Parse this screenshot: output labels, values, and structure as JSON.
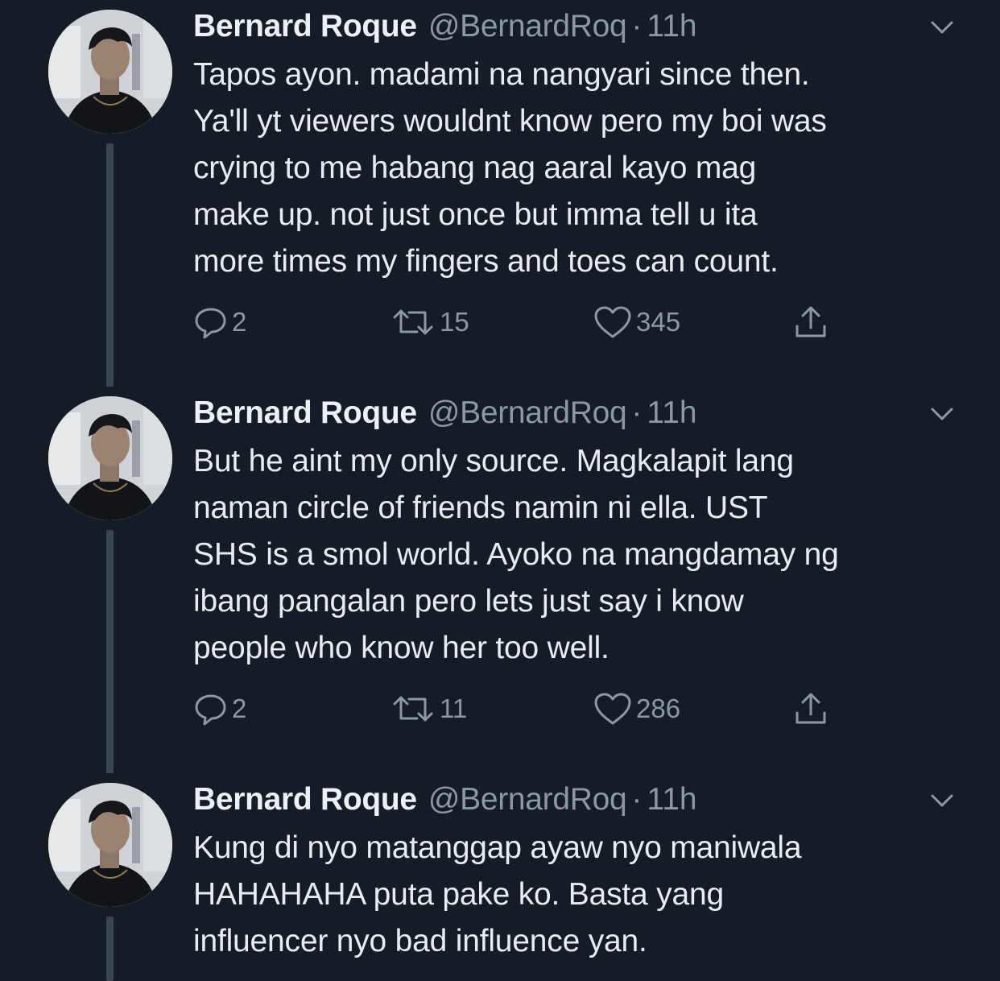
{
  "tweets": [
    {
      "author": {
        "name": "Bernard Roque",
        "handle": "@BernardRoq",
        "separator": "·",
        "time": "11h"
      },
      "lines": [
        "Tapos ayon. madami na nangyari since then.",
        "Ya'll yt viewers wouldnt know pero my boi was",
        "crying to me habang nag aaral kayo mag",
        "make up. not just once but imma tell u ita",
        "more times my fingers and toes can count."
      ],
      "stats": {
        "replies": "2",
        "retweets": "15",
        "likes": "345"
      }
    },
    {
      "author": {
        "name": "Bernard Roque",
        "handle": "@BernardRoq",
        "separator": "·",
        "time": "11h"
      },
      "lines": [
        "But he aint my only source. Magkalapit lang",
        "naman circle of friends namin ni ella. UST",
        "SHS is a smol world. Ayoko na mangdamay ng",
        "ibang pangalan pero lets just say i know",
        "people who know her too well."
      ],
      "stats": {
        "replies": "2",
        "retweets": "11",
        "likes": "286"
      }
    },
    {
      "author": {
        "name": "Bernard Roque",
        "handle": "@BernardRoq",
        "separator": "·",
        "time": "11h"
      },
      "lines": [
        "Kung di nyo matanggap ayaw nyo maniwala",
        "HAHAHAHA puta pake ko. Basta yang",
        "influencer nyo bad influence yan."
      ]
    }
  ],
  "icons": {
    "reply": "reply-icon",
    "retweet": "retweet-icon",
    "like": "like-icon",
    "share": "share-icon",
    "menu": "chevron-down-icon"
  },
  "colors": {
    "background": "#151c26",
    "text": "#e9ecef",
    "secondary": "#8a98a8",
    "thread_line": "#3a4654"
  }
}
